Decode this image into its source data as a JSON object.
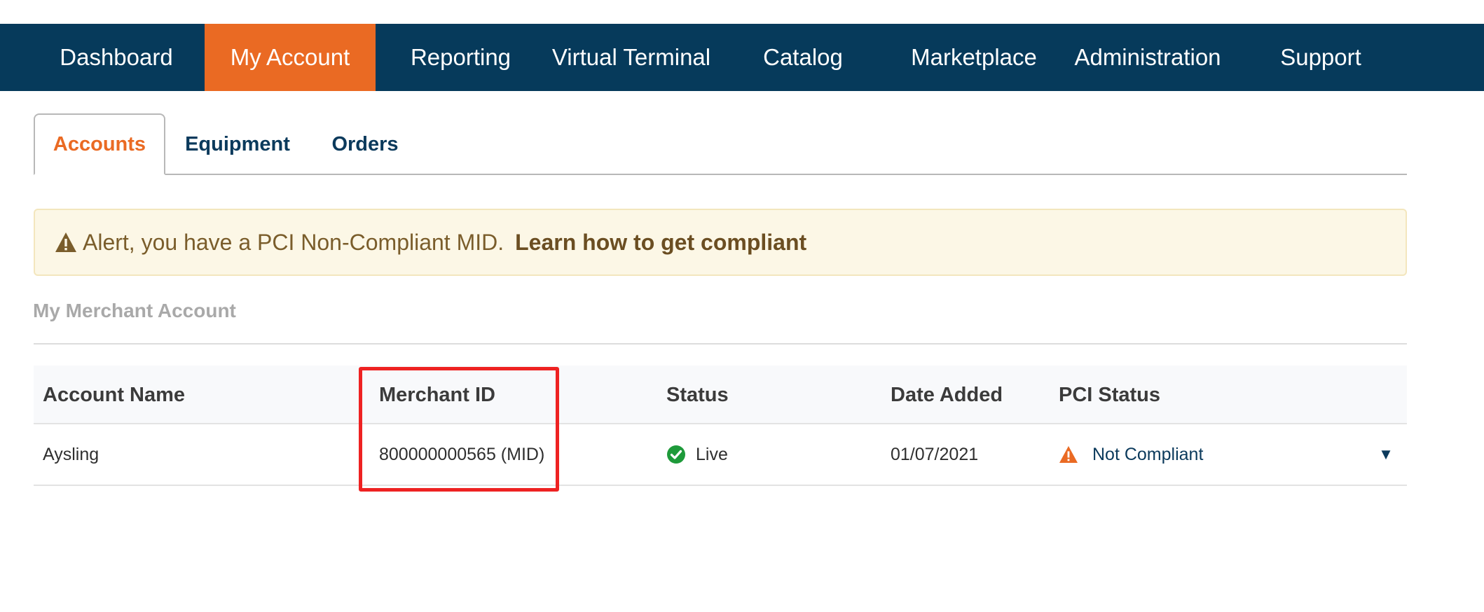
{
  "nav": {
    "items": [
      {
        "label": "Dashboard"
      },
      {
        "label": "My Account"
      },
      {
        "label": "Reporting"
      },
      {
        "label": "Virtual Terminal"
      },
      {
        "label": "Catalog"
      },
      {
        "label": "Marketplace"
      },
      {
        "label": "Administration"
      },
      {
        "label": "Support"
      }
    ],
    "active": "My Account"
  },
  "tabs": {
    "items": [
      {
        "label": "Accounts"
      },
      {
        "label": "Equipment"
      },
      {
        "label": "Orders"
      }
    ],
    "active": "Accounts"
  },
  "alert": {
    "icon": "warning-triangle-icon",
    "message": "Alert, you have a PCI Non-Compliant MID.",
    "link": "Learn how to get compliant"
  },
  "section": {
    "title": "My Merchant Account"
  },
  "table": {
    "headers": {
      "account_name": "Account Name",
      "merchant_id": "Merchant ID",
      "status": "Status",
      "date_added": "Date Added",
      "pci_status": "PCI Status"
    },
    "rows": [
      {
        "account_name": "Aysling",
        "merchant_id": "800000000565 (MID)",
        "status": "Live",
        "status_icon": "check-circle-icon",
        "date_added": "01/07/2021",
        "pci_status": "Not Compliant",
        "pci_icon": "warning-triangle-icon",
        "expand_icon": "caret-down-icon"
      }
    ]
  },
  "colors": {
    "nav_bg": "#063a5b",
    "accent": "#ea6a23",
    "alert_bg": "#fcf7e6",
    "status_live": "#1e9a3a",
    "highlight": "#ee2222"
  }
}
